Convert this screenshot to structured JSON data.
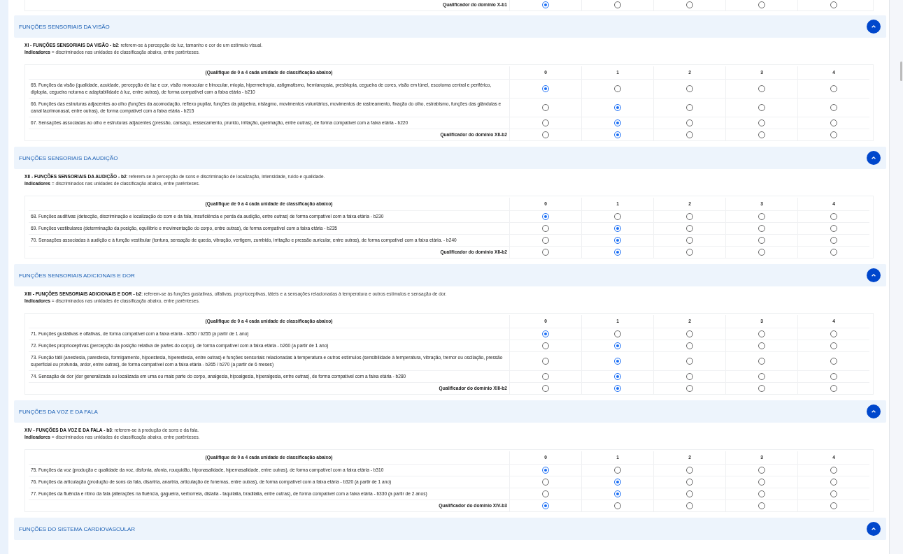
{
  "top_fragment": {
    "qualifier": {
      "label": "Qualificador do domínio X-b1",
      "options": [
        {
          "selected": true
        },
        {
          "selected": false
        },
        {
          "selected": false
        },
        {
          "selected": false
        },
        {
          "selected": false
        }
      ]
    }
  },
  "sections": [
    {
      "title": "FUNÇÕES SENSORIAIS DA VISÃO",
      "expanded": true,
      "intro": "**XI - FUNÇÕES SENSORIAIS DA VISÃO - b2**: referem-se à percepção de luz, tamanho e cor de um estímulo visual.",
      "indicators": "**Indicadores** = discriminados nas unidades de classificação abaixo, entre parênteses.",
      "table": {
        "header": "(Qualifique de 0 a 4 cada unidade de classificação abaixo)",
        "scale": [
          "0",
          "1",
          "2",
          "3",
          "4"
        ],
        "rows": [
          {
            "text": "65. Funções da visão (qualidade, acuidade, percepção de luz e cor, visão monocular e binocular, miopia, hipermetropia, astigmatismo, hemianopsia, presbiopia, cegueira de cores, visão em túnel, escotoma central e periférico, diplopia, cegueira noturna e adaptabilidade à luz, entre outras), de forma compatível com a faixa etária - b210",
            "options": [
              {
                "selected": true
              },
              {
                "selected": false
              },
              {
                "selected": false
              },
              {
                "selected": false
              },
              {
                "selected": false
              }
            ]
          },
          {
            "text": "66. Funções das estruturas adjacentes ao olho (funções da acomodação, reflexo pupilar, funções da pálpebra, nistagmo, movimentos voluntários, movimentos de rastreamento, fixação do olho, estrabismo, funções das glândulas e canal lacrimonasal, entre outras), de forma compatível com a faixa etária - b215",
            "options": [
              {
                "selected": false
              },
              {
                "selected": true
              },
              {
                "selected": false
              },
              {
                "selected": false
              },
              {
                "selected": false
              }
            ]
          },
          {
            "text": "67. Sensações associadas ao olho e estruturas adjacentes (pressão, cansaço, ressecamento, prurido, irritação, queimação, entre outras), de forma compatível com a faixa etária - b220",
            "options": [
              {
                "selected": false
              },
              {
                "selected": true
              },
              {
                "selected": false
              },
              {
                "selected": false
              },
              {
                "selected": false
              }
            ]
          }
        ],
        "qualifier": {
          "label": "Qualificador do domínio XII-b2",
          "options": [
            {
              "selected": false
            },
            {
              "selected": true
            },
            {
              "selected": false
            },
            {
              "selected": false
            },
            {
              "selected": false
            }
          ]
        }
      }
    },
    {
      "title": "FUNÇÕES SENSORIAIS DA AUDIÇÃO",
      "expanded": true,
      "intro": "**XII - FUNÇÕES SENSORIAIS DA AUDIÇÃO - b2**: referem-se à percepção de sons e discriminação de localização, intensidade, ruído e qualidade.",
      "indicators": "**Indicadores** = discriminados nas unidades de classificação abaixo, entre parênteses.",
      "table": {
        "header": "(Qualifique de 0 a 4 cada unidade de classificação abaixo)",
        "scale": [
          "0",
          "1",
          "2",
          "3",
          "4"
        ],
        "rows": [
          {
            "text": "68. Funções auditivas (detecção, discriminação e localização do som e da fala, insuficiência e perda da audição, entre outras) de forma compatível com a faixa etária - b230",
            "options": [
              {
                "selected": true
              },
              {
                "selected": false
              },
              {
                "selected": false
              },
              {
                "selected": false
              },
              {
                "selected": false
              }
            ]
          },
          {
            "text": "69. Funções vestibulares (determinação da posição, equilíbrio e movimentação do corpo, entre outras), de forma compatível com a faixa etária - b235",
            "options": [
              {
                "selected": false
              },
              {
                "selected": true
              },
              {
                "selected": false
              },
              {
                "selected": false
              },
              {
                "selected": false
              }
            ]
          },
          {
            "text": "70. Sensações associadas à audição e à função vestibular (tontura, sensação de queda, vibração, vertigem, zumbido, irritação e pressão auricular, entre outras), de forma compatível com a faixa etária. - b240",
            "options": [
              {
                "selected": false
              },
              {
                "selected": true
              },
              {
                "selected": false
              },
              {
                "selected": false
              },
              {
                "selected": false
              }
            ]
          }
        ],
        "qualifier": {
          "label": "Qualificador do domínio XII-b2",
          "options": [
            {
              "selected": false
            },
            {
              "selected": true
            },
            {
              "selected": false
            },
            {
              "selected": false
            },
            {
              "selected": false
            }
          ]
        }
      }
    },
    {
      "title": "FUNÇÕES SENSORIAIS ADICIONAIS E DOR",
      "expanded": true,
      "intro": "**XIII - FUNÇÕES SENSORIAIS ADICIONAIS E DOR - b2**: referem-se às funções gustativas, olfativas, proprioceptivas, táteis e a sensações relacionadas à temperatura e outros estímulos e sensação de dor.",
      "indicators": "**Indicadores** = discriminados nas unidades de classificação abaixo, entre parênteses.",
      "table": {
        "header": "(Qualifique de 0 a 4 cada unidade de classificação abaixo)",
        "scale": [
          "0",
          "1",
          "2",
          "3",
          "4"
        ],
        "rows": [
          {
            "text": "71. Funções gustativas e olfativas, de forma compatível com a faixa etária - b250 / b255 (a partir de 1 ano)",
            "options": [
              {
                "selected": true
              },
              {
                "selected": false
              },
              {
                "selected": false
              },
              {
                "selected": false
              },
              {
                "selected": false
              }
            ]
          },
          {
            "text": "72. Funções proprioceptivas (percepção da posição relativa de partes do corpo), de forma compatível com a faixa etária - b260 (a partir de 1 ano)",
            "options": [
              {
                "selected": false
              },
              {
                "selected": true
              },
              {
                "selected": false
              },
              {
                "selected": false
              },
              {
                "selected": false
              }
            ]
          },
          {
            "text": "73. Função tátil (anestesia, parestesia, formigamento, hipoestesia, hiperestesia, entre outras) e funções sensoriais relacionadas à temperatura e outros estímulos (sensibilidade à temperatura, vibração, tremor ou oscilação, pressão superficial ou profunda, ardor, entre outras), de forma compatível com a faixa etária - b265 / b270 (a partir de 6 meses)",
            "options": [
              {
                "selected": false
              },
              {
                "selected": true
              },
              {
                "selected": false
              },
              {
                "selected": false
              },
              {
                "selected": false
              }
            ]
          },
          {
            "text": "74. Sensação de dor (dor generalizada ou localizada em uma ou mais parte do corpo, analgesia, hipoalgesia, hiperalgesia, entre outras), de forma compatível com a faixa etária - b280",
            "options": [
              {
                "selected": false
              },
              {
                "selected": true
              },
              {
                "selected": false
              },
              {
                "selected": false
              },
              {
                "selected": false
              }
            ]
          }
        ],
        "qualifier": {
          "label": "Qualificador do domínio XIII-b2",
          "options": [
            {
              "selected": false
            },
            {
              "selected": true
            },
            {
              "selected": false
            },
            {
              "selected": false
            },
            {
              "selected": false
            }
          ]
        }
      }
    },
    {
      "title": "FUNÇÕES DA VOZ E DA FALA",
      "expanded": true,
      "intro": "**XIV - FUNÇÕES DA VOZ E DA FALA - b3**: referem-se à produção de sons e da fala.",
      "indicators": "**Indicadores** = discriminados nas unidades de classificação abaixo, entre parênteses.",
      "table": {
        "header": "(Qualifique de 0 a 4 cada unidade de classificação abaixo)",
        "scale": [
          "0",
          "1",
          "2",
          "3",
          "4"
        ],
        "rows": [
          {
            "text": "75. Funções da voz (produção e qualidade da voz, disfonia, afonia, rouquidão, hiponasalidade, hipernasalidade, entre outras), de forma compatível com a faixa etária - b310",
            "options": [
              {
                "selected": true
              },
              {
                "selected": false
              },
              {
                "selected": false
              },
              {
                "selected": false
              },
              {
                "selected": false
              }
            ]
          },
          {
            "text": "76. Funções da articulação (produção de sons da fala, disartria, anartria, articulação de fonemas, entre outras), de forma compatível com a faixa etária - b320 (a partir de 1 ano)",
            "options": [
              {
                "selected": false
              },
              {
                "selected": true
              },
              {
                "selected": false
              },
              {
                "selected": false
              },
              {
                "selected": false
              }
            ]
          },
          {
            "text": "77. Funções da fluência e ritmo da fala (alterações na fluência, gagueira, verborreia, dislalia - taquilalia, bradilalia, entre outras), de forma compatível com a faixa etária - b330 (a partir de 2 anos)",
            "options": [
              {
                "selected": false
              },
              {
                "selected": true
              },
              {
                "selected": false
              },
              {
                "selected": false
              },
              {
                "selected": false
              }
            ]
          }
        ],
        "qualifier": {
          "label": "Qualificador do domínio XIV-b3",
          "options": [
            {
              "selected": true
            },
            {
              "selected": false
            },
            {
              "selected": false
            },
            {
              "selected": false
            },
            {
              "selected": false
            }
          ]
        }
      }
    },
    {
      "title": "FUNÇÕES DO SISTEMA CARDIOVASCULAR",
      "expanded": true
    }
  ]
}
